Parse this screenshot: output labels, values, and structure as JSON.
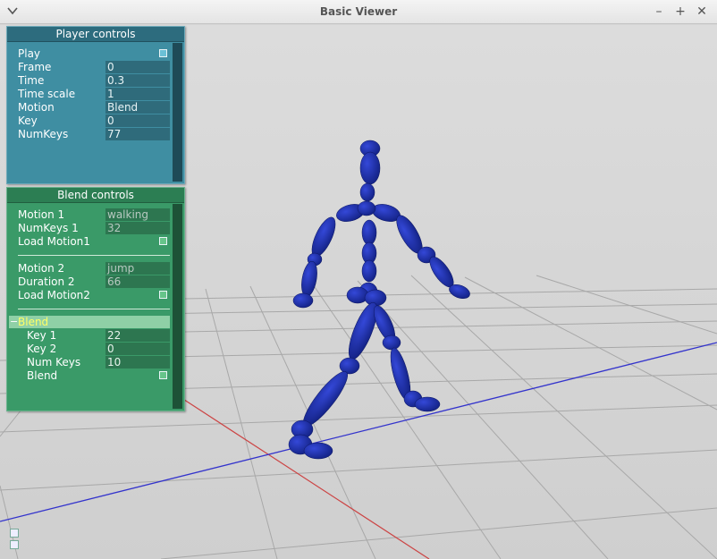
{
  "window": {
    "title": "Basic Viewer",
    "buttons": [
      "–",
      "+",
      "✕"
    ]
  },
  "player_controls": {
    "title": "Player controls",
    "rows": [
      {
        "label": "Play",
        "type": "checkbox"
      },
      {
        "label": "Frame",
        "value": "0"
      },
      {
        "label": "Time",
        "value": "0.3"
      },
      {
        "label": "Time scale",
        "value": "1"
      },
      {
        "label": "Motion",
        "value": "Blend"
      },
      {
        "label": "Key",
        "value": "0"
      },
      {
        "label": "NumKeys",
        "value": "77"
      }
    ]
  },
  "blend_controls": {
    "title": "Blend controls",
    "motion1": {
      "label": "Motion 1",
      "value": "walking"
    },
    "numkeys1": {
      "label": "NumKeys 1",
      "value": "32"
    },
    "load1": {
      "label": "Load Motion1"
    },
    "motion2": {
      "label": "Motion 2",
      "value": "jump"
    },
    "duration2": {
      "label": "Duration 2",
      "value": "66"
    },
    "load2": {
      "label": "Load Motion2"
    },
    "group": {
      "label": "Blend",
      "rows": [
        {
          "label": "Key 1",
          "value": "22"
        },
        {
          "label": "Key 2",
          "value": "0"
        },
        {
          "label": "Num Keys",
          "value": "10"
        },
        {
          "label": "Blend",
          "type": "checkbox"
        }
      ]
    }
  },
  "scene": {
    "figure_color": "#1a2a9e",
    "x_axis_color": "#c44",
    "z_axis_color": "#33c"
  },
  "icons": [
    "window-menu-icon",
    "minimize-icon",
    "maximize-icon",
    "close-icon",
    "axis-toggle-icon",
    "settings-toggle-icon"
  ]
}
